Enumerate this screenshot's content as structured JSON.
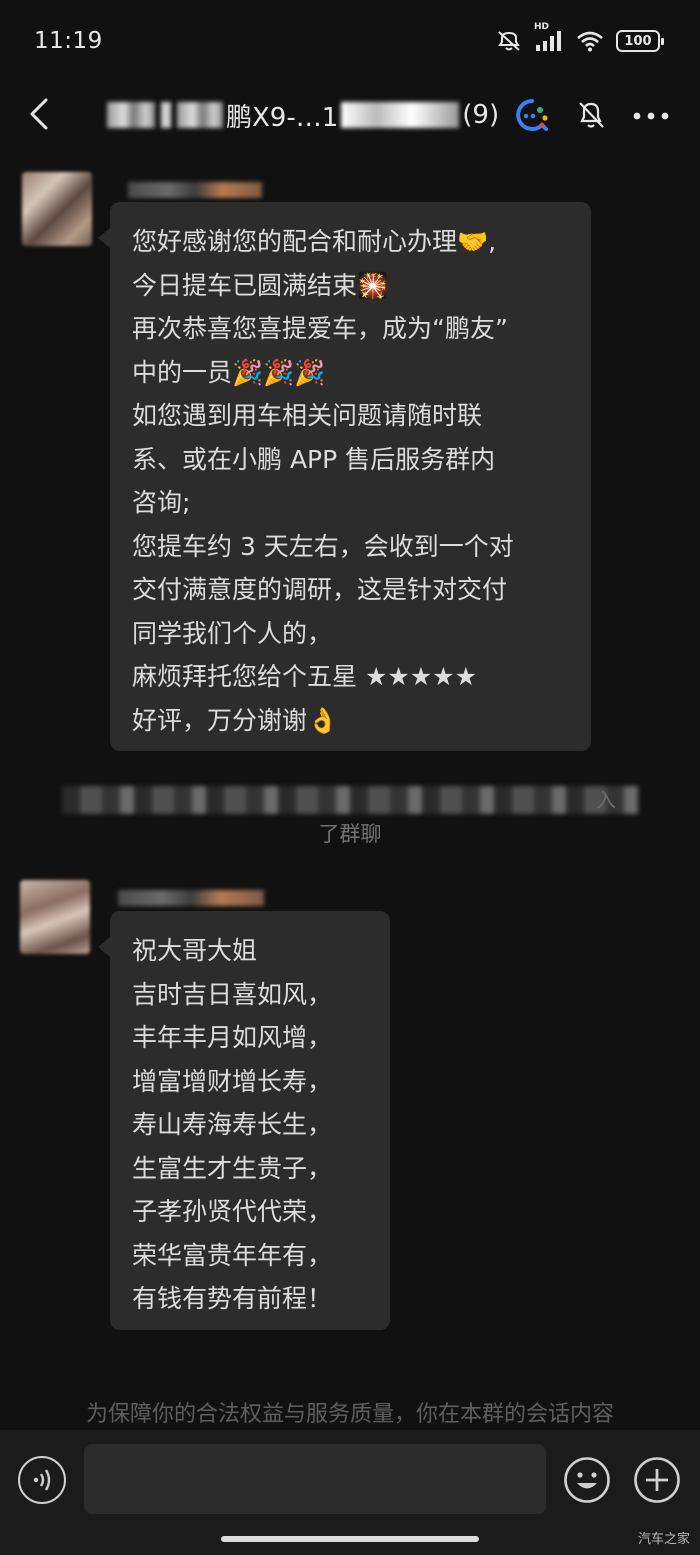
{
  "status_bar": {
    "time": "11:19",
    "signal_tag": "HD",
    "battery": "100"
  },
  "header": {
    "title_visible": "鹏X9-…1",
    "member_count": "(9)"
  },
  "messages": [
    {
      "lines": [
        "您好感谢您的配合和耐心办理🤝,",
        "今日提车已圆满结束🎇",
        "再次恭喜您喜提爱车，成为“鹏友”",
        "中的一员🎉🎉🎉",
        "如您遇到用车相关问题请随时联",
        "系、或在小鹏 APP 售后服务群内",
        "咨询;",
        "您提车约 3 天左右，会收到一个对",
        "交付满意度的调研，这是针对交付",
        "同学我们个人的，",
        "麻烦拜托您给个五星 ★★★★★",
        "好评，万分谢谢👌"
      ]
    },
    {
      "lines": [
        "祝大哥大姐",
        "吉时吉日喜如风，",
        "丰年丰月如风增，",
        "增富增财增长寿，",
        "寿山寿海寿长生，",
        "生富生才生贵子，",
        "子孝孙贤代代荣，",
        "荣华富贵年年有，",
        "有钱有势有前程！"
      ]
    }
  ],
  "system": {
    "join_suffix": "入",
    "join_text": "了群聊"
  },
  "notice": "为保障你的合法权益与服务质量，你在本群的会话内容",
  "input": {
    "placeholder": ""
  },
  "watermark": "汽车之家",
  "icons": {
    "back": "chevron-left-icon",
    "group": "ai-assistant-icon",
    "mute": "bell-off-icon",
    "more": "more-dots-icon",
    "voice": "voice-icon",
    "emoji": "emoji-icon",
    "plus": "plus-icon"
  }
}
